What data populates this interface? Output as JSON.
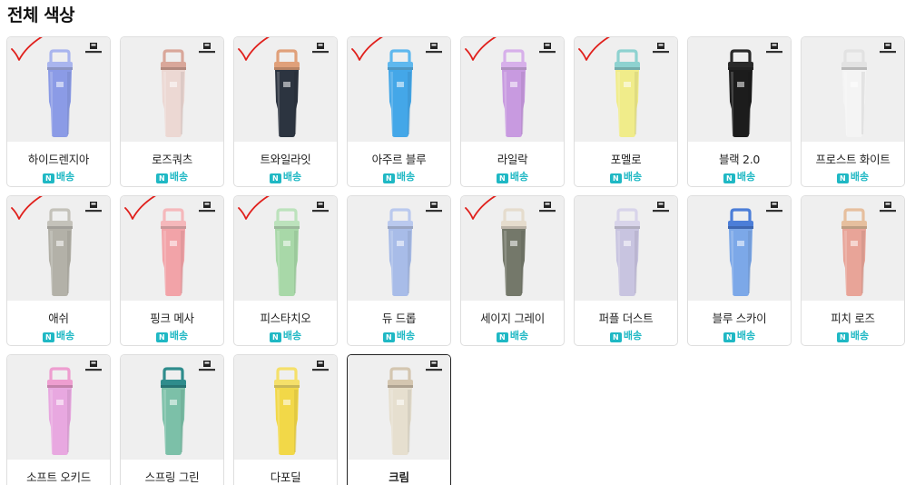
{
  "page_title": "전체 색상",
  "delivery_badge": {
    "icon": "N",
    "label": "배송",
    "color": "#1fb8c4"
  },
  "products": [
    {
      "name": "하이드렌지아",
      "body_color": "#8b9be6",
      "lid_color": "#a9b5ee",
      "checked": true,
      "selected": false
    },
    {
      "name": "로즈쿼츠",
      "body_color": "#ecd8d3",
      "lid_color": "#d9a79a",
      "checked": false,
      "selected": false
    },
    {
      "name": "트와일라잇",
      "body_color": "#2c3440",
      "lid_color": "#e0a07a",
      "checked": true,
      "selected": false
    },
    {
      "name": "아주르 블루",
      "body_color": "#44a7e8",
      "lid_color": "#5fb8ee",
      "checked": true,
      "selected": false
    },
    {
      "name": "라일락",
      "body_color": "#c89ae0",
      "lid_color": "#d7b0ea",
      "checked": true,
      "selected": false
    },
    {
      "name": "포멜로",
      "body_color": "#f0ec8a",
      "lid_color": "#8ed2d0",
      "checked": true,
      "selected": false
    },
    {
      "name": "블랙 2.0",
      "body_color": "#1c1c1c",
      "lid_color": "#2a2a2a",
      "checked": false,
      "selected": false
    },
    {
      "name": "프로스트 화이트",
      "body_color": "#f4f4f4",
      "lid_color": "#e2e2e2",
      "checked": false,
      "selected": false
    },
    {
      "name": "애쉬",
      "body_color": "#b3b1a8",
      "lid_color": "#c4c2ba",
      "checked": true,
      "selected": false
    },
    {
      "name": "핑크 메사",
      "body_color": "#f2a3a8",
      "lid_color": "#f5b8bb",
      "checked": true,
      "selected": false
    },
    {
      "name": "피스타치오",
      "body_color": "#a8d8a8",
      "lid_color": "#bce2bc",
      "checked": true,
      "selected": false
    },
    {
      "name": "듀 드롭",
      "body_color": "#a8bce8",
      "lid_color": "#bac9ee",
      "checked": false,
      "selected": false
    },
    {
      "name": "세이지 그레이",
      "body_color": "#74786a",
      "lid_color": "#e5dccd",
      "checked": true,
      "selected": false
    },
    {
      "name": "퍼플 더스트",
      "body_color": "#c8c4e0",
      "lid_color": "#d8d4ea",
      "checked": false,
      "selected": false
    },
    {
      "name": "블루 스카이",
      "body_color": "#7ca8e8",
      "lid_color": "#4c7ed8",
      "checked": false,
      "selected": false
    },
    {
      "name": "피치 로즈",
      "body_color": "#e8a498",
      "lid_color": "#e6bf9e",
      "checked": false,
      "selected": false
    },
    {
      "name": "소프트 오키드",
      "body_color": "#e8a8e0",
      "lid_color": "#ee9ed0",
      "checked": false,
      "selected": false
    },
    {
      "name": "스프링 그린",
      "body_color": "#7cc0a8",
      "lid_color": "#2f8c8c",
      "checked": false,
      "selected": false
    },
    {
      "name": "다포딜",
      "body_color": "#f2d848",
      "lid_color": "#f5e06a",
      "checked": false,
      "selected": false
    },
    {
      "name": "크림",
      "body_color": "#e6dfcf",
      "lid_color": "#d4c6b0",
      "checked": false,
      "selected": true
    }
  ]
}
